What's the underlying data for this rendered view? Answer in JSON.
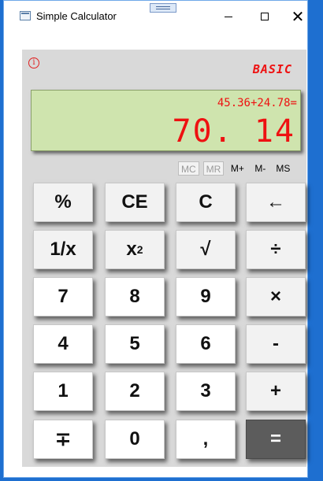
{
  "window": {
    "title": "Simple Calculator",
    "close_symbol": "✕"
  },
  "calculator": {
    "mode_label": "BASIC",
    "info_symbol": "i",
    "display": {
      "expression": "45.36+24.78=",
      "result": "70. 14"
    },
    "memory": [
      "MC",
      "MR",
      "M+",
      "M-",
      "MS"
    ],
    "keys": {
      "percent": "%",
      "ce": "CE",
      "clear": "C",
      "backspace": "←",
      "reciprocal": "1/x",
      "square_base": "x",
      "square_exp": "2",
      "sqrt": "√",
      "divide": "÷",
      "d7": "7",
      "d8": "8",
      "d9": "9",
      "multiply": "×",
      "d4": "4",
      "d5": "5",
      "d6": "6",
      "minus": "-",
      "d1": "1",
      "d2": "2",
      "d3": "3",
      "plus": "+",
      "negate": "∓",
      "d0": "0",
      "comma": ",",
      "equals": "="
    }
  },
  "colors": {
    "display_bg": "#cfe4ae",
    "display_text": "#ee1111",
    "equals_bg": "#5c5c5c",
    "panel_bg": "#d9d9d9"
  }
}
